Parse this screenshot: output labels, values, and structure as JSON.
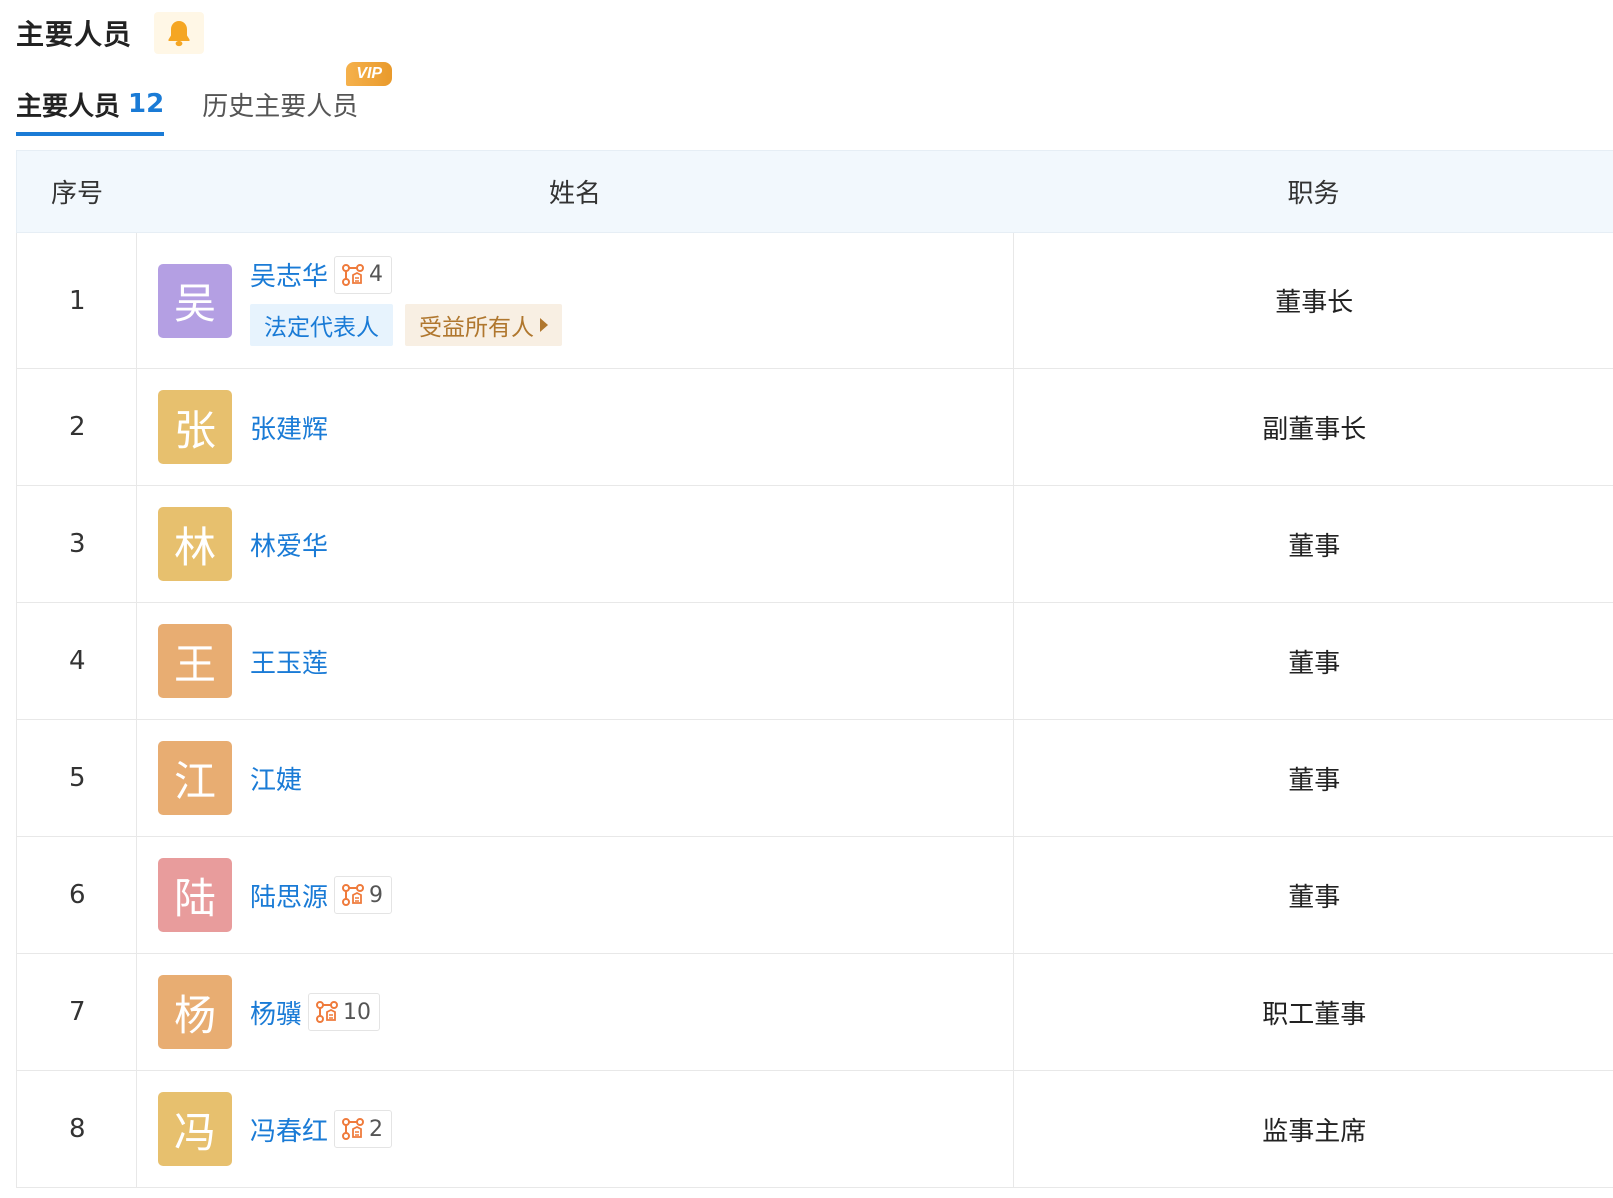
{
  "header": {
    "title": "主要人员",
    "bell_icon": "bell-icon"
  },
  "tabs": {
    "active_label": "主要人员",
    "active_count": "12",
    "inactive_label": "历史主要人员",
    "vip_badge": "VIP"
  },
  "table": {
    "headers": {
      "index": "序号",
      "name": "姓名",
      "position": "职务"
    },
    "rows": [
      {
        "index": "1",
        "avatar_char": "吴",
        "avatar_color": "#b49fe3",
        "name": "吴志华",
        "enterprise_count": "4",
        "tags": {
          "legal": "法定代表人",
          "beneficiary": "受益所有人"
        },
        "position": "董事长"
      },
      {
        "index": "2",
        "avatar_char": "张",
        "avatar_color": "#e7c06e",
        "name": "张建辉",
        "enterprise_count": null,
        "position": "副董事长"
      },
      {
        "index": "3",
        "avatar_char": "林",
        "avatar_color": "#e7c06e",
        "name": "林爱华",
        "enterprise_count": null,
        "position": "董事"
      },
      {
        "index": "4",
        "avatar_char": "王",
        "avatar_color": "#e8ad72",
        "name": "王玉莲",
        "enterprise_count": null,
        "position": "董事"
      },
      {
        "index": "5",
        "avatar_char": "江",
        "avatar_color": "#e8ad72",
        "name": "江婕",
        "enterprise_count": null,
        "position": "董事"
      },
      {
        "index": "6",
        "avatar_char": "陆",
        "avatar_color": "#e89c9c",
        "name": "陆思源",
        "enterprise_count": "9",
        "position": "董事"
      },
      {
        "index": "7",
        "avatar_char": "杨",
        "avatar_color": "#e8ad72",
        "name": "杨骥",
        "enterprise_count": "10",
        "position": "职工董事"
      },
      {
        "index": "8",
        "avatar_char": "冯",
        "avatar_color": "#e7c06e",
        "name": "冯春红",
        "enterprise_count": "2",
        "position": "监事主席"
      }
    ]
  },
  "colors": {
    "link_blue": "#1a7bd6",
    "header_bg": "#f2f8fd",
    "enterprise_icon": "#ef7b3c"
  },
  "icons": {
    "enterprise_icon": "enterprise-network-icon",
    "caret": "caret-right-icon"
  }
}
